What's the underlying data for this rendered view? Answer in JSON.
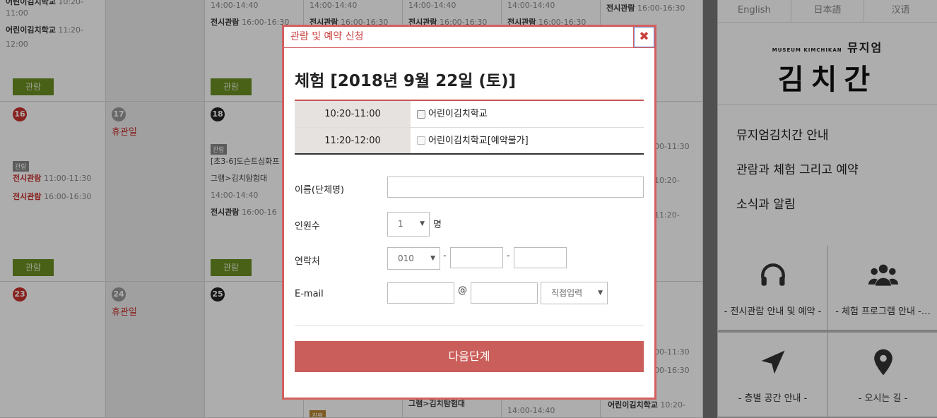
{
  "calendar": {
    "row1": {
      "c1_l1_name": "어린이김치학교",
      "c1_l1_time": "10:20-",
      "c1_l1b": "11:00",
      "c1_l2_name": "어린이김치학교",
      "c1_l2_time": "11:20-",
      "c1_l2b": "12:00",
      "c3_time": "14:00-14:40",
      "c3_name": "전시관람",
      "c3_name_time": "16:00-16:30",
      "c4_time": "14:00-14:40",
      "c4_name": "전시관람",
      "c4_name_time": "16:00-16:30",
      "c5_time": "14:00-14:40",
      "c5_name": "전시관람",
      "c5_name_time": "16:00-16:30",
      "c6_time": "14:00-14:40",
      "c6_name": "전시관람",
      "c6_name_time": "16:00-16:30",
      "c7_name": "전시관람",
      "c7_name_time": "16:00-16:30",
      "btn": "관람"
    },
    "row2": {
      "d1": "16",
      "d2": "17",
      "d3": "18",
      "closed": "휴관일",
      "tag": "관람",
      "c1_l1_name": "전시관람",
      "c1_l1_time": "11:00-11:30",
      "c1_l2_name": "전시관람",
      "c1_l2_time": "16:00-16:30",
      "c3_l1": "[초3-6]도슨트심화프",
      "c3_l2": "그램>김치탐험대",
      "c3_time": "14:00-14:40",
      "c3_name": "전시관람",
      "c3_name_time": "16:00-16",
      "c7_a": "00-11:30",
      "c7_b": "10:20-",
      "c7_c": "11:20-",
      "btn": "관람"
    },
    "row3": {
      "d1": "23",
      "d2": "24",
      "d3": "25",
      "closed": "휴관일",
      "c5_l1": "그램>김치탐험대",
      "c5_t1": "14:00-14:40",
      "c7_a": "00-11:30",
      "c7_b": "00-16:30",
      "c7_name": "어린이김치학교",
      "c7_name_time": "10:20-",
      "tag": "관람"
    }
  },
  "right_panel": {
    "languages": [
      "English",
      "日本語",
      "汉语"
    ],
    "logo": {
      "small_en": "MUSEUM KIMCHIKAN",
      "small_kr": "뮤지엄",
      "big_kr": "김치간"
    },
    "menu": [
      "뮤지엄김치간 안내",
      "관람과 체험 그리고 예약",
      "소식과 알림"
    ],
    "tiles": [
      {
        "icon": "headphones-icon",
        "label": "- 전시관람 안내 및 예약 -"
      },
      {
        "icon": "group-icon",
        "label": "- 체험 프로그램 안내 -…"
      },
      {
        "icon": "navigation-arrow-icon",
        "label": "- 층별 공간 안내 -"
      },
      {
        "icon": "map-pin-icon",
        "label": "- 오시는 길 -"
      }
    ]
  },
  "modal": {
    "title": "관람 및 예약 신청",
    "close_glyph": "✖",
    "heading": "체험 [2018년 9월 22일 (토)]",
    "slots": [
      {
        "time": "10:20-11:00",
        "option": "어린이김치학교",
        "disabled": false
      },
      {
        "time": "11:20-12:00",
        "option": "어린이김치학교[예약불가]",
        "disabled": true
      }
    ],
    "form": {
      "name_label": "이름(단체명)",
      "name_value": "",
      "people_label": "인원수",
      "people_value": "1",
      "people_unit": "명",
      "phone_label": "연락처",
      "phone_prefix": "010",
      "phone_sep": "-",
      "email_label": "E-mail",
      "email_at": "@",
      "email_domain_select": "직접입력"
    },
    "next_button": "다음단계"
  },
  "colors": {
    "accent": "#ca5e5a",
    "calendar_red": "#c9312e",
    "button_green": "#6b8f22"
  }
}
